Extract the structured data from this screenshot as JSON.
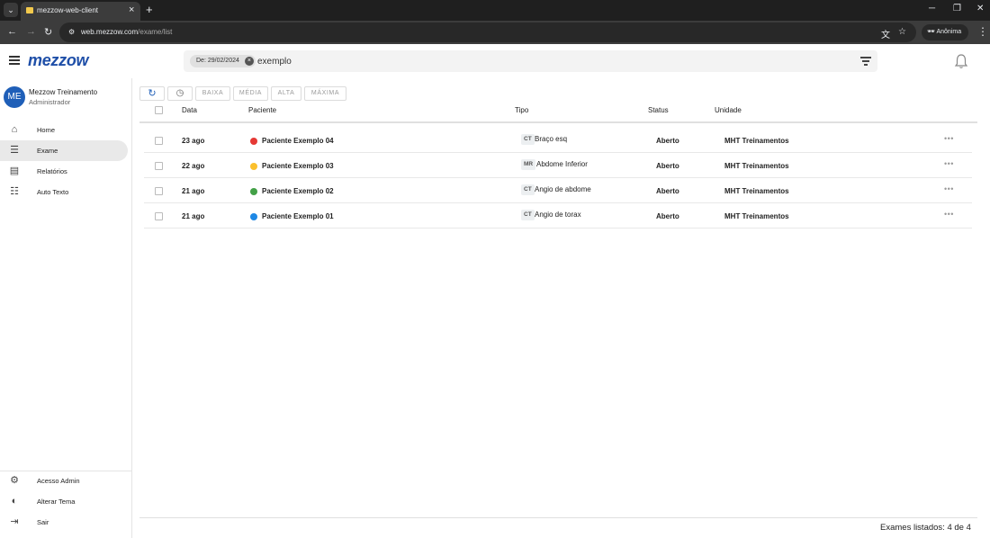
{
  "browser": {
    "tab_title": "mezzow-web-client",
    "url_host": "web.mezzow.com",
    "url_path": "/exame/list",
    "profile_label": "Anônima"
  },
  "header": {
    "logo": "mezzow",
    "filter_chip": "De: 29/02/2024",
    "search_value": "exemplo"
  },
  "user": {
    "initials": "ME",
    "name": "Mezzow Treinamento",
    "role": "Administrador"
  },
  "nav": {
    "home": "Home",
    "exame": "Exame",
    "relatorios": "Relatórios",
    "auto_texto": "Auto Texto",
    "acesso_admin": "Acesso Admin",
    "alterar_tema": "Alterar Tema",
    "sair": "Sair"
  },
  "toolbar": {
    "baixa": "BAIXA",
    "media": "MÉDIA",
    "alta": "ALTA",
    "maxima": "MÁXIMA"
  },
  "columns": {
    "data": "Data",
    "paciente": "Paciente",
    "tipo": "Tipo",
    "status": "Status",
    "unidade": "Unidade"
  },
  "rows": [
    {
      "data": "23 ago",
      "paciente": "Paciente Exemplo 04",
      "priority_color": "#e53935",
      "modalidade": "CT",
      "tipo": "Braço esq",
      "status": "Aberto",
      "unidade": "MHT Treinamentos"
    },
    {
      "data": "22 ago",
      "paciente": "Paciente Exemplo 03",
      "priority_color": "#fbc02d",
      "modalidade": "MR",
      "tipo": "Abdome Inferior",
      "status": "Aberto",
      "unidade": "MHT Treinamentos"
    },
    {
      "data": "21 ago",
      "paciente": "Paciente Exemplo 02",
      "priority_color": "#43a047",
      "modalidade": "CT",
      "tipo": "Angio de abdome",
      "status": "Aberto",
      "unidade": "MHT Treinamentos"
    },
    {
      "data": "21 ago",
      "paciente": "Paciente Exemplo 01",
      "priority_color": "#1e88e5",
      "modalidade": "CT",
      "tipo": "Angio de torax",
      "status": "Aberto",
      "unidade": "MHT Treinamentos"
    }
  ],
  "footer": {
    "count_text": "Exames listados: 4 de 4"
  }
}
